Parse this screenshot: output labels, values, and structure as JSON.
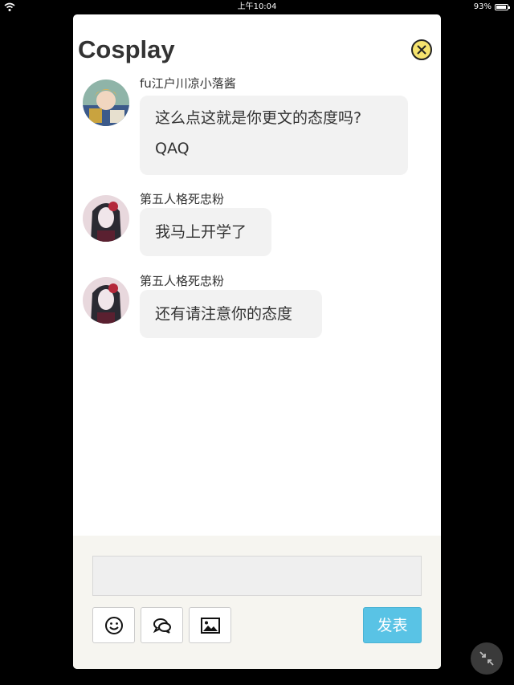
{
  "status_bar": {
    "time": "上午10:04",
    "battery": "93%"
  },
  "header": {
    "title": "Cosplay"
  },
  "messages": [
    {
      "username": "fu江户川凉小落酱",
      "lines": [
        "这么点这就是你更文的态度吗?",
        "QAQ"
      ]
    },
    {
      "username": "第五人格死忠粉",
      "lines": [
        "我马上开学了"
      ]
    },
    {
      "username": "第五人格死忠粉",
      "lines": [
        "还有请注意你的态度"
      ]
    }
  ],
  "composer": {
    "input_value": "",
    "tools": [
      "emoji-icon",
      "quote-icon",
      "image-icon"
    ],
    "send_label": "发表"
  },
  "colors": {
    "send_button": "#59c3e5",
    "close_button": "#f5e36e",
    "composer_bg": "#f6f5f0"
  }
}
